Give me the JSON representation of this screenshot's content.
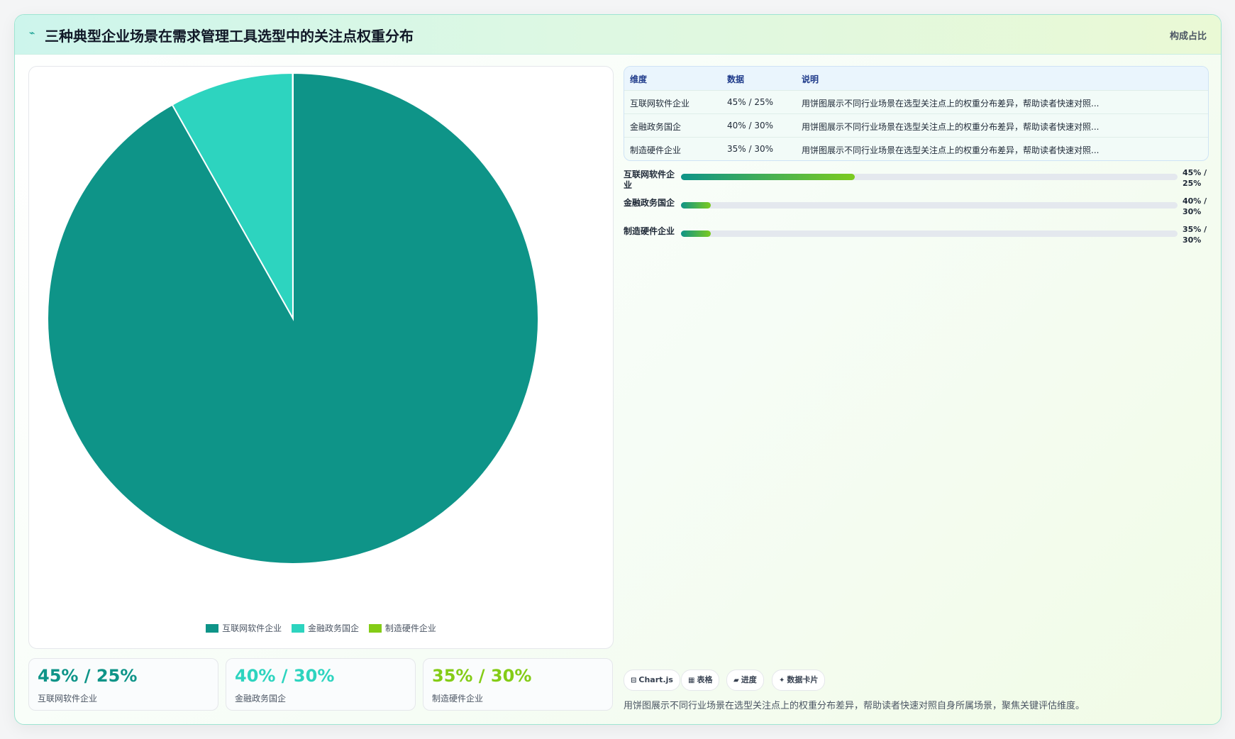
{
  "header": {
    "icon": "lightning-icon",
    "title": "三种典型企业场景在需求管理工具选型中的关注点权重分布",
    "tag": "构成占比"
  },
  "chart_data": {
    "type": "pie",
    "categories": [
      "互联网软件企业",
      "金融政务国企",
      "制造硬件企业"
    ],
    "values": [
      [
        45,
        25
      ],
      [
        40,
        30
      ],
      [
        35,
        30
      ]
    ],
    "pie_values": [
      0.45,
      0.04,
      0.0001
    ],
    "colors": [
      "#0e9488",
      "#2dd4bf",
      "#84cc16"
    ],
    "legend": [
      "互联网软件企业",
      "金融政务国企",
      "制造硬件企业"
    ],
    "legend_position": "bottom"
  },
  "stats": [
    {
      "value": "45% / 25%",
      "label": "互联网软件企业",
      "color": "#0e9488"
    },
    {
      "value": "40% / 30%",
      "label": "金融政务国企",
      "color": "#2dd4bf"
    },
    {
      "value": "35% / 30%",
      "label": "制造硬件企业",
      "color": "#84cc16"
    }
  ],
  "table": {
    "headers": [
      "维度",
      "数据",
      "说明"
    ],
    "rows": [
      [
        "互联网软件企业",
        "45% / 25%",
        "用饼图展示不同行业场景在选型关注点上的权重分布差异，帮助读者快速对照..."
      ],
      [
        "金融政务国企",
        "40% / 30%",
        "用饼图展示不同行业场景在选型关注点上的权重分布差异，帮助读者快速对照..."
      ],
      [
        "制造硬件企业",
        "35% / 30%",
        "用饼图展示不同行业场景在选型关注点上的权重分布差异，帮助读者快速对照..."
      ]
    ]
  },
  "progress": [
    {
      "label": "互联网软件企业",
      "value": "45% / 25%",
      "fraction": 0.35
    },
    {
      "label": "金融政务国企",
      "value": "40% / 30%",
      "fraction": 0.06
    },
    {
      "label": "制造硬件企业",
      "value": "35% / 30%",
      "fraction": 0.06
    }
  ],
  "pills": [
    {
      "icon": "chart-icon",
      "glyph": "⊟",
      "label": "Chart.js"
    },
    {
      "icon": "table-icon",
      "glyph": "▦",
      "label": "表格"
    },
    {
      "icon": "progress-icon",
      "glyph": "▰",
      "label": "进度"
    },
    {
      "icon": "sparkle-icon",
      "glyph": "✦",
      "label": "数据卡片"
    }
  ],
  "footnote": "用饼图展示不同行业场景在选型关注点上的权重分布差异，帮助读者快速对照自身所属场景，聚焦关键评估维度。"
}
